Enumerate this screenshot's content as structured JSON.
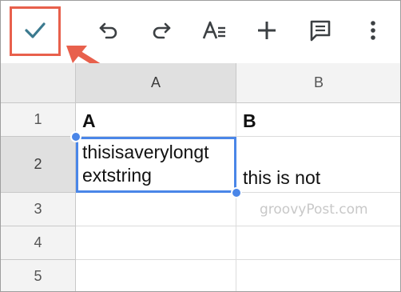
{
  "toolbar": {
    "buttons": [
      {
        "name": "confirm-check-icon",
        "color": "#3b7a8f"
      },
      {
        "name": "undo-icon"
      },
      {
        "name": "redo-icon"
      },
      {
        "name": "text-format-icon"
      },
      {
        "name": "plus-icon"
      },
      {
        "name": "comment-icon"
      },
      {
        "name": "more-vert-icon"
      }
    ]
  },
  "columns": [
    "A",
    "B"
  ],
  "rows": [
    "1",
    "2",
    "3",
    "4",
    "5"
  ],
  "cells": {
    "a1": "A",
    "b1": "B",
    "a2_line1": "thisisaverylongt",
    "a2_line2": "extstring",
    "b2": "this is not"
  },
  "watermark": "groovyPost.com",
  "colors": {
    "accent": "#4a86e8",
    "highlight": "#e8604c",
    "icon": "#3c4043"
  }
}
